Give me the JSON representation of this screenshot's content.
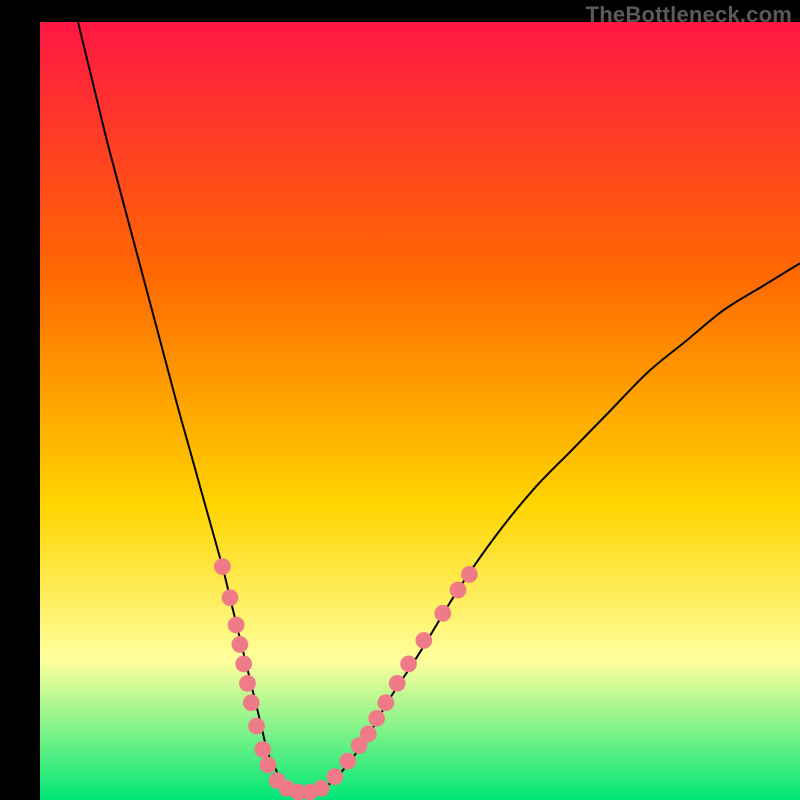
{
  "watermark": "TheBottleneck.com",
  "colors": {
    "frame_bg": "#000000",
    "gradient_top": "#ff1744",
    "gradient_mid1": "#ff6a00",
    "gradient_mid2": "#ffd400",
    "gradient_pale": "#ffff9c",
    "gradient_bottom": "#00e676",
    "curve": "#000000",
    "marker_fill": "#f07b88",
    "marker_stroke": "#f07b88",
    "watermark": "#5a5a5a"
  },
  "chart_data": {
    "type": "line",
    "title": "",
    "xlabel": "",
    "ylabel": "",
    "xlim": [
      0,
      100
    ],
    "ylim": [
      0,
      100
    ],
    "grid": false,
    "legend": false,
    "series": [
      {
        "name": "bottleneck-curve",
        "x": [
          5,
          7,
          9,
          12,
          15,
          18,
          20,
          22,
          24,
          25,
          26,
          27,
          28,
          29,
          30,
          31,
          32,
          34,
          36,
          38,
          40,
          43,
          46,
          50,
          55,
          60,
          65,
          70,
          75,
          80,
          85,
          90,
          95,
          100
        ],
        "y": [
          100,
          92,
          84,
          73,
          62,
          51,
          44,
          37,
          30,
          26,
          22,
          18,
          14,
          10,
          6,
          4,
          2,
          1,
          1,
          2,
          4,
          8,
          13,
          19,
          27,
          34,
          40,
          45,
          50,
          55,
          59,
          63,
          66,
          69
        ]
      }
    ],
    "markers": [
      {
        "x": 24.0,
        "y": 30
      },
      {
        "x": 25.0,
        "y": 26
      },
      {
        "x": 25.8,
        "y": 22.5
      },
      {
        "x": 26.3,
        "y": 20
      },
      {
        "x": 26.8,
        "y": 17.5
      },
      {
        "x": 27.3,
        "y": 15
      },
      {
        "x": 27.8,
        "y": 12.5
      },
      {
        "x": 28.5,
        "y": 9.5
      },
      {
        "x": 29.3,
        "y": 6.5
      },
      {
        "x": 30.0,
        "y": 4.5
      },
      {
        "x": 31.2,
        "y": 2.5
      },
      {
        "x": 32.5,
        "y": 1.5
      },
      {
        "x": 34.0,
        "y": 1
      },
      {
        "x": 35.5,
        "y": 1
      },
      {
        "x": 37.0,
        "y": 1.5
      },
      {
        "x": 38.8,
        "y": 3
      },
      {
        "x": 40.5,
        "y": 5
      },
      {
        "x": 42.0,
        "y": 7
      },
      {
        "x": 43.2,
        "y": 8.5
      },
      {
        "x": 44.3,
        "y": 10.5
      },
      {
        "x": 45.5,
        "y": 12.5
      },
      {
        "x": 47.0,
        "y": 15
      },
      {
        "x": 48.5,
        "y": 17.5
      },
      {
        "x": 50.5,
        "y": 20.5
      },
      {
        "x": 53.0,
        "y": 24
      },
      {
        "x": 55.0,
        "y": 27
      },
      {
        "x": 56.5,
        "y": 29
      }
    ],
    "marker_radius_data_units": 1.1
  }
}
